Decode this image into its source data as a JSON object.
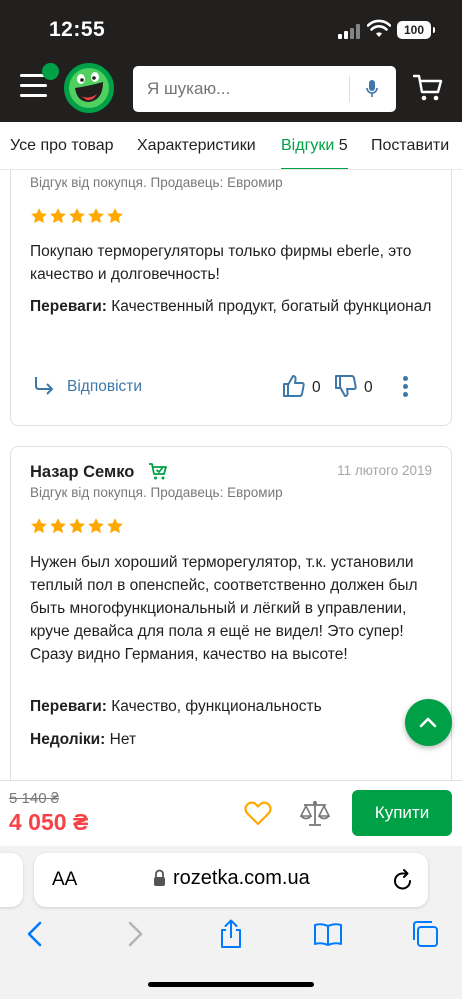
{
  "status_bar": {
    "time": "12:55",
    "battery": "100"
  },
  "header": {
    "search_placeholder": "Я шукаю...",
    "brand_color": "#00a046",
    "icons": [
      "menu-icon",
      "rozetka-logo",
      "microphone-icon",
      "cart-icon"
    ]
  },
  "tabs": [
    {
      "label": "Усе про товар"
    },
    {
      "label": "Характеристики"
    },
    {
      "label": "Відгуки",
      "count": "5",
      "active": true
    },
    {
      "label": "Поставити"
    }
  ],
  "reviews": [
    {
      "buyer_note": "Відгук від покупця. Продавець: Евромир",
      "rating": 5,
      "text": "Покупаю терморегуляторы только фирмы eberle, это качество и долговечность!",
      "pros_label": "Переваги:",
      "pros": "Качественный продукт, богатый функционал",
      "reply_label": "Відповісти",
      "likes": "0",
      "dislikes": "0"
    },
    {
      "author": "Назар Семко",
      "date": "11 лютого 2019",
      "buyer_note": "Відгук від покупця. Продавець: Евромир",
      "rating": 5,
      "text": "Нужен был хороший терморегулятор, т.к. установили теплый пол в опенспейс, соответственно должен был быть многофункциональный и лёгкий в управлении, круче девайса для пола я ещё не видел! Это супер! Сразу видно Германия, качество на высоте!",
      "pros_label": "Переваги:",
      "pros": "Качество, функциональность",
      "cons_label": "Недоліки:",
      "cons": "Нет"
    }
  ],
  "buy_bar": {
    "old_price": "5 140 ₴",
    "price": "4 050 ₴",
    "buy_label": "Купити",
    "price_color": "#f84147"
  },
  "browser": {
    "text_size_label": "AA",
    "url": "rozetka.com.ua"
  }
}
